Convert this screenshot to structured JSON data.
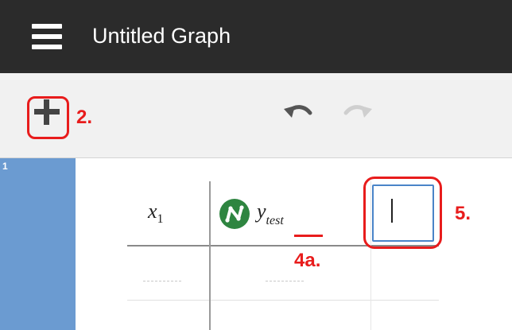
{
  "header": {
    "title": "Untitled Graph",
    "menu_icon": "hamburger-menu-icon",
    "background": "#2b2b2b"
  },
  "toolbar": {
    "add_icon": "plus-icon",
    "undo_icon": "undo-icon",
    "redo_icon": "redo-icon"
  },
  "expression_list": {
    "items": [
      {
        "index": "1",
        "type": "table",
        "columns": [
          {
            "name": "x",
            "subscript": "1"
          },
          {
            "name": "y",
            "subscript": "test",
            "icon": "regression-icon"
          }
        ],
        "new_column_input": ""
      }
    ],
    "selected_color": "#6b9bd1"
  },
  "annotations": {
    "step_2": "2.",
    "step_4a": "4a.",
    "step_5": "5.",
    "color": "#e81c1c"
  }
}
